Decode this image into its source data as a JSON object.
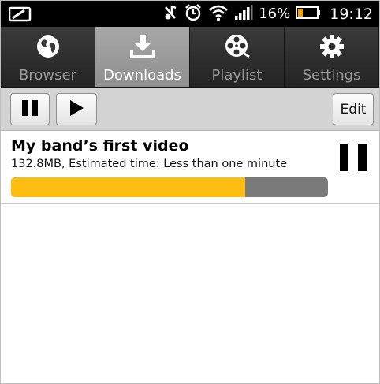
{
  "status_bar": {
    "battery_percent": "16%",
    "time": "19:12",
    "icons": [
      "screen-icon",
      "muted-icon",
      "alarm-icon",
      "wifi-icon",
      "signal-icon",
      "battery-icon"
    ]
  },
  "tabs": [
    {
      "label": "Browser",
      "icon": "globe-icon",
      "active": false
    },
    {
      "label": "Downloads",
      "icon": "download-icon",
      "active": true
    },
    {
      "label": "Playlist",
      "icon": "film-reel-icon",
      "active": false
    },
    {
      "label": "Settings",
      "icon": "gear-icon",
      "active": false
    }
  ],
  "toolbar": {
    "edit_label": "Edit"
  },
  "downloads": [
    {
      "title": "My band’s first video",
      "meta": "132.8MB, Estimated time: Less than one minute",
      "progress": 0.74
    }
  ],
  "colors": {
    "progress_fill": "#fdbd13",
    "progress_track": "#7a7a7a",
    "active_tab": "#9c9c9c",
    "tab_bar": "#2d2d2d"
  }
}
